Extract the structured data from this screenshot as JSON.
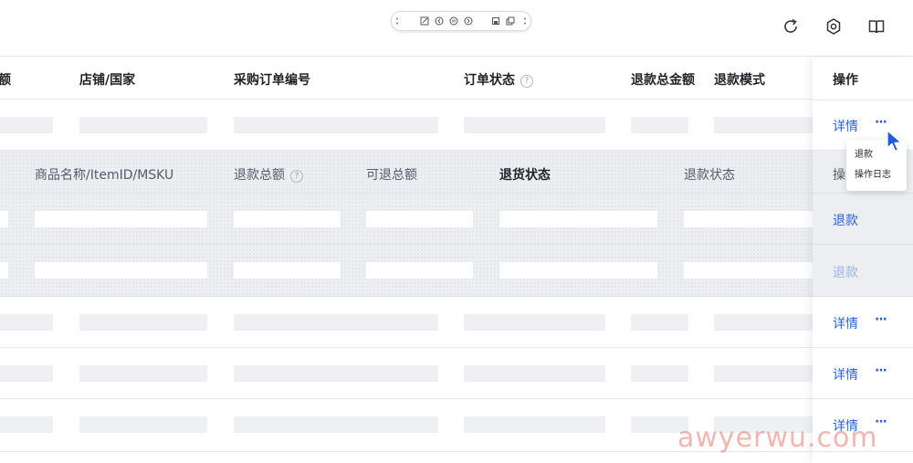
{
  "toolbar": {
    "icons": [
      "drag-handle-icon",
      "edit-icon",
      "prev-icon",
      "pause-icon",
      "next-icon",
      "save-icon",
      "copy-icon",
      "menu-dots-icon"
    ]
  },
  "top_actions": [
    "refresh-icon",
    "settings-icon",
    "book-icon"
  ],
  "header": {
    "col_cut": "额",
    "col_shop": "店铺/国家",
    "col_po": "采购订单编号",
    "col_status": "订单状态",
    "col_refund_total": "退款总金额",
    "col_refund_mode": "退款模式",
    "col_action": "操作"
  },
  "subheader": {
    "col_product": "商品名称/ItemID/MSKU",
    "col_refund_sum": "退款总额",
    "col_refundable": "可退总额",
    "col_return_status": "退货状态",
    "col_refund_status": "退款状态",
    "col_action_cut": "操"
  },
  "actions": {
    "detail": "详情",
    "more": "···",
    "refund": "退款"
  },
  "dropdown": {
    "items": [
      "退款",
      "操作日志"
    ]
  },
  "watermark": "awyerwu.com",
  "colors": {
    "link": "#2962d9",
    "link_disabled": "#9bb4e6",
    "cursor": "#1d5ce0"
  }
}
